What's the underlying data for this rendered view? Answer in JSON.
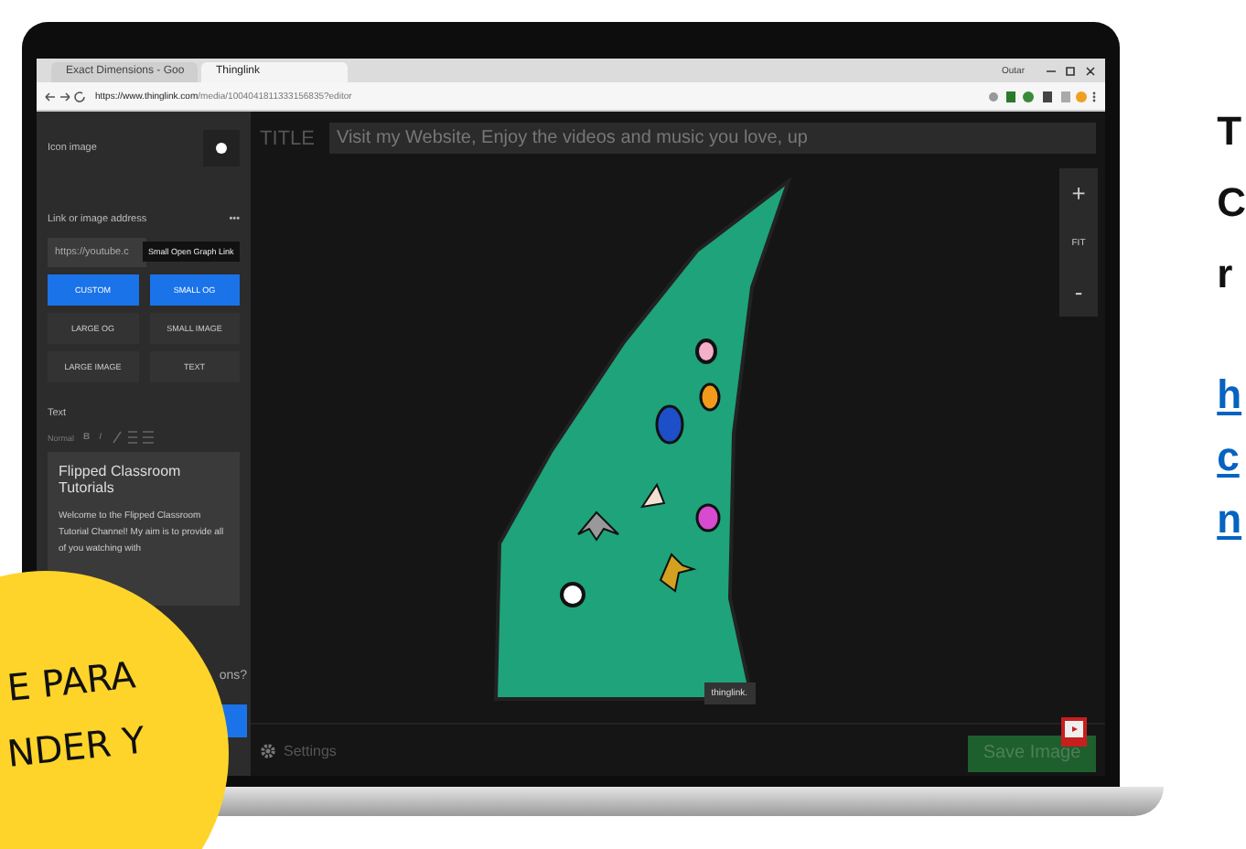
{
  "browser": {
    "tabs": [
      {
        "title": "Exact Dimensions - Goo",
        "selected": false
      },
      {
        "title": "Thinglink",
        "selected": true
      }
    ],
    "profile": "Outar",
    "url_host": "https://www.thinglink.com",
    "url_path": "/media/1004041811333156835?editor"
  },
  "sidebar": {
    "icon_label": "Icon image",
    "link_label": "Link or image address",
    "more": "•••",
    "link_value": "https://youtube.c",
    "tooltip": "Small Open Graph Link",
    "link_types": [
      {
        "label": "CUSTOM",
        "selected": true
      },
      {
        "label": "SMALL OG",
        "selected": true
      },
      {
        "label": "LARGE OG",
        "selected": false
      },
      {
        "label": "SMALL IMAGE",
        "selected": false
      },
      {
        "label": "LARGE IMAGE",
        "selected": false
      },
      {
        "label": "TEXT",
        "selected": false
      }
    ],
    "text_label": "Text",
    "format": "Normal",
    "format_buttons": [
      "B",
      "I"
    ],
    "text_heading": "Flipped Classroom Tutorials",
    "text_body": "Welcome to the Flipped Classroom Tutorial Channel! My aim is to provide all of you watching with",
    "question": "ons?"
  },
  "editor": {
    "title_label": "TITLE",
    "title_value": "Visit my Website, Enjoy the videos and music you love, up",
    "zoom": [
      "+",
      "FIT",
      "-"
    ],
    "watermark": "thinglink.",
    "settings": "Settings",
    "save": "Save Image"
  },
  "slide": {
    "heading_lines": [
      "T",
      "C",
      "r"
    ],
    "link_lines": [
      "h",
      "c",
      "n"
    ],
    "badge_lines": [
      "E PARA",
      "NDER Y"
    ]
  }
}
